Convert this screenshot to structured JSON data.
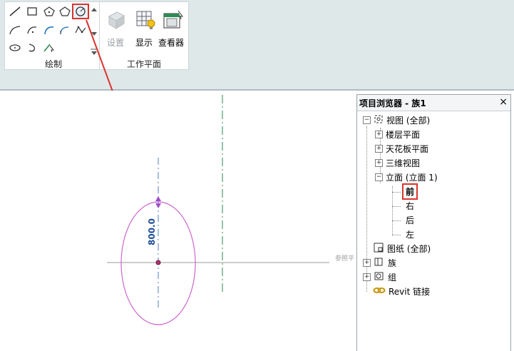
{
  "ribbon": {
    "draw_panel_label": "绘制",
    "workplane_panel_label": "工作平面",
    "buttons": {
      "set": "设置",
      "show": "显示",
      "viewer": "查看器"
    }
  },
  "canvas": {
    "dimension_text": "800.0",
    "ref_plane_label": "参照平"
  },
  "browser": {
    "title": "项目浏览器 - 族1",
    "close": "×",
    "items": [
      {
        "label": "视图 (全部)",
        "expander": "⊟"
      },
      {
        "label": "楼层平面",
        "expander": "⊞"
      },
      {
        "label": "天花板平面",
        "expander": "⊞"
      },
      {
        "label": "三维视图",
        "expander": "⊞"
      },
      {
        "label": "立面 (立面 1)",
        "expander": "⊟"
      },
      {
        "label": "前"
      },
      {
        "label": "右"
      },
      {
        "label": "后"
      },
      {
        "label": "左"
      },
      {
        "label": "图纸 (全部)"
      },
      {
        "label": "族",
        "expander": "⊞"
      },
      {
        "label": "组",
        "expander": "⊞"
      },
      {
        "label": "Revit 链接"
      }
    ]
  },
  "colors": {
    "highlight": "#d9342b",
    "ellipse": "#cc66cc",
    "dimension": "#1f4f9a",
    "ref_plane": "#2d8a55"
  }
}
